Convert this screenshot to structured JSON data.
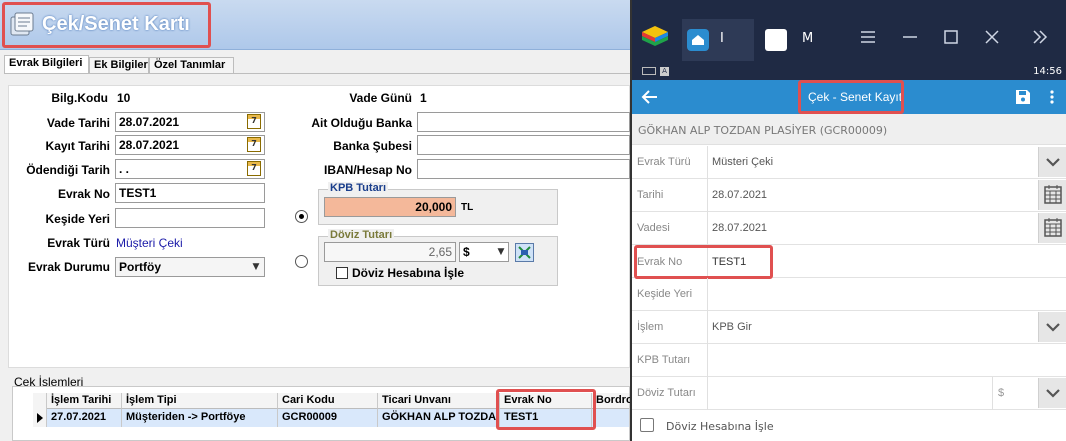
{
  "window": {
    "title": "Çek/Senet Kartı",
    "tabs": [
      "Evrak Bilgileri",
      "Ek Bilgiler",
      "Özel Tanımlar"
    ],
    "form": {
      "bilg_kodu_label": "Bilg.Kodu",
      "bilg_kodu_value": "10",
      "vade_tarihi_label": "Vade Tarihi",
      "vade_tarihi_value": "28.07.2021",
      "kayit_tarihi_label": "Kayıt Tarihi",
      "kayit_tarihi_value": "28.07.2021",
      "odendigi_tarih_label": "Ödendiği Tarih",
      "odendigi_tarih_value": ". .",
      "evrak_no_label": "Evrak No",
      "evrak_no_value": "TEST1",
      "keside_yeri_label": "Keşide Yeri",
      "keside_yeri_value": "",
      "evrak_turu_label": "Evrak Türü",
      "evrak_turu_value": "Müşteri Çeki",
      "evrak_durumu_label": "Evrak Durumu",
      "evrak_durumu_value": "Portföy",
      "vade_gunu_label": "Vade Günü",
      "vade_gunu_value": "1",
      "ait_banka_label": "Ait Olduğu Banka",
      "banka_subesi_label": "Banka Şubesi",
      "iban_label": "IBAN/Hesap No",
      "calendar_glyph": "7",
      "kpb_title": "KPB Tutarı",
      "kpb_value": "20,000",
      "kpb_currency": "TL",
      "doviz_title": "Döviz Tutarı",
      "doviz_value": "2,65",
      "doviz_currency": "$",
      "doviz_checkbox_label": "Döviz Hesabına İşle",
      "kpb_color": "#f4b89a",
      "evrak_turu_color": "#1a1aa8"
    },
    "cek_islemleri": {
      "title": "Çek İşlemleri",
      "columns": [
        "İşlem Tarihi",
        "İşlem Tipi",
        "Cari Kodu",
        "Ticari Unvanı",
        "Evrak No",
        "Bordro"
      ],
      "row": [
        "27.07.2021",
        "Müşteriden -> Portföye",
        "GCR00009",
        "GÖKHAN ALP TOZDAN",
        "TEST1",
        ""
      ]
    }
  },
  "phone": {
    "tab2_label": "I",
    "tab3_label": "M",
    "time": "14:56",
    "appbar_title": "Çek - Senet Kayıt",
    "customer": "GÖKHAN ALP TOZDAN PLASİYER (GCR00009)",
    "fields": [
      {
        "label": "Evrak Türü",
        "value": "Müsteri Çeki"
      },
      {
        "label": "Tarihi",
        "value": "28.07.2021"
      },
      {
        "label": "Vadesi",
        "value": "28.07.2021"
      },
      {
        "label": "Evrak No",
        "value": "TEST1"
      },
      {
        "label": "Keşide Yeri",
        "value": ""
      },
      {
        "label": "İşlem",
        "value": "KPB Gir"
      },
      {
        "label": "KPB Tutarı",
        "value": ""
      },
      {
        "label": "Döviz Tutarı",
        "value": ""
      }
    ],
    "doviz_currency": "$",
    "checkbox_label": "Döviz Hesabına İşle",
    "appbar_color": "#2b8ccf"
  }
}
